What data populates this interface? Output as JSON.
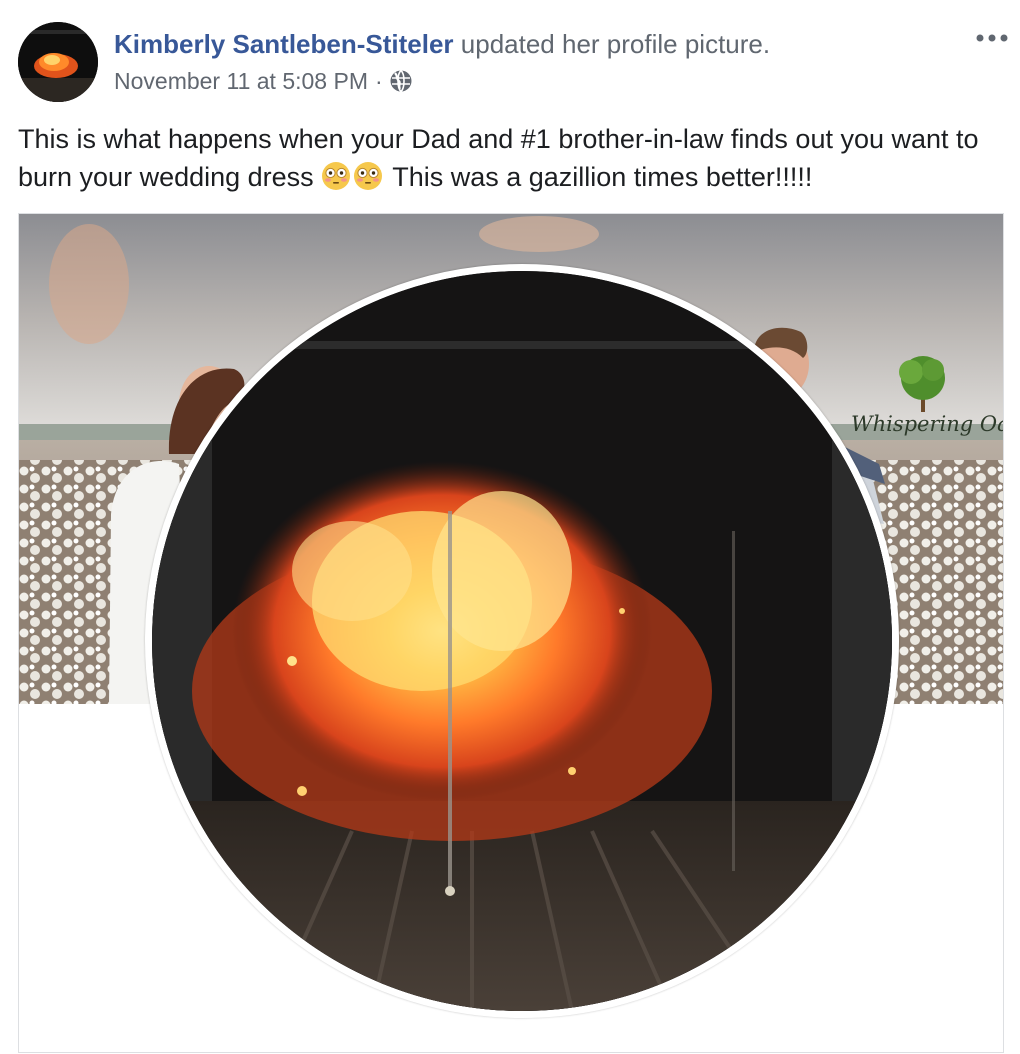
{
  "post": {
    "author": "Kimberly Santleben-Stiteler",
    "action": "updated her profile picture.",
    "timestamp": "November 11 at 5:08 PM",
    "separator": "·",
    "audience_icon": "globe-icon",
    "menu_icon": "more-options-icon",
    "caption_part1": "This is what happens when your Dad and #1 brother-in-law finds out you want to burn your wedding dress",
    "caption_emojis": [
      "flushed-face-emoji",
      "flushed-face-emoji"
    ],
    "caption_part2": "This was a gazillion times better!!!!!"
  },
  "media": {
    "cover_watermark": "Whispering Oak",
    "profile_picture_subject": "explosion-fireball"
  },
  "colors": {
    "link_blue": "#385898",
    "secondary_text": "#616770",
    "primary_text": "#1c1e21",
    "border": "#dddfe2"
  }
}
